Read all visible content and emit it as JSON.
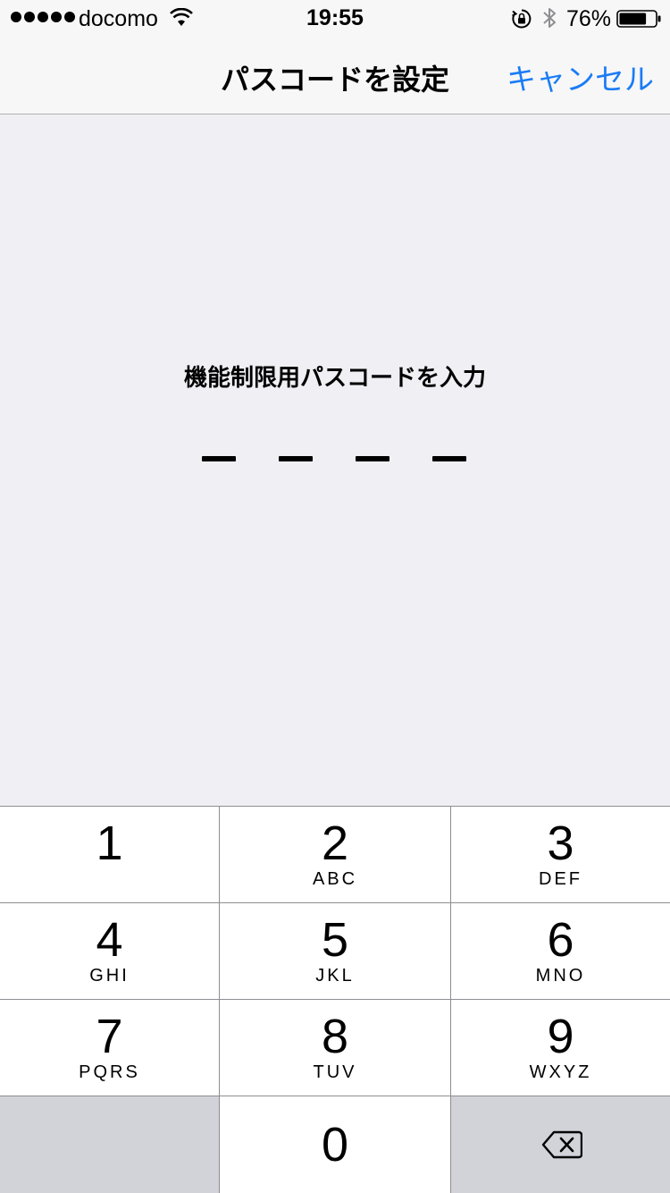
{
  "status_bar": {
    "carrier": "docomo",
    "time": "19:55",
    "battery_percent": "76%",
    "battery_level": 0.76
  },
  "nav": {
    "title": "パスコードを設定",
    "cancel_label": "キャンセル"
  },
  "prompt": "機能制限用パスコードを入力",
  "passcode": {
    "length": 4,
    "entered": 0
  },
  "keypad": {
    "keys": [
      {
        "digit": "1",
        "letters": ""
      },
      {
        "digit": "2",
        "letters": "ABC"
      },
      {
        "digit": "3",
        "letters": "DEF"
      },
      {
        "digit": "4",
        "letters": "GHI"
      },
      {
        "digit": "5",
        "letters": "JKL"
      },
      {
        "digit": "6",
        "letters": "MNO"
      },
      {
        "digit": "7",
        "letters": "PQRS"
      },
      {
        "digit": "8",
        "letters": "TUV"
      },
      {
        "digit": "9",
        "letters": "WXYZ"
      },
      {
        "digit": "0",
        "letters": ""
      }
    ]
  },
  "colors": {
    "accent": "#1a7cf5",
    "background": "#efeff4",
    "bar_background": "#f7f7f7",
    "key_background": "#ffffff",
    "special_key_background": "#d1d3d9"
  },
  "icons": [
    "wifi-icon",
    "rotation-lock-icon",
    "bluetooth-icon",
    "battery-icon",
    "delete-backspace-icon"
  ]
}
